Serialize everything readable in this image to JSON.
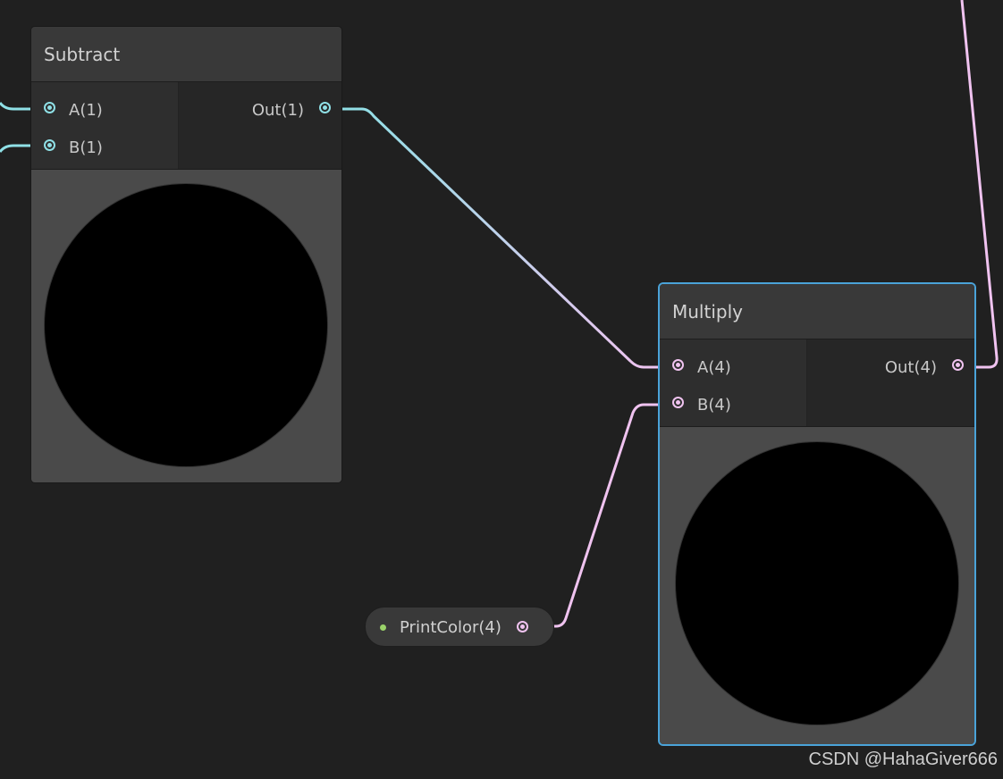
{
  "colors": {
    "background": "#202020",
    "float_port": "#8fe0e6",
    "vector4_port": "#f0c3f0",
    "selection_outline": "#4aa3d9",
    "property_dot": "#9bd36a"
  },
  "subtract_node": {
    "title": "Subtract",
    "inputs": [
      {
        "label": "A(1)",
        "port_icon": "float-port-icon"
      },
      {
        "label": "B(1)",
        "port_icon": "float-port-icon"
      }
    ],
    "output": {
      "label": "Out(1)",
      "port_icon": "float-port-icon"
    },
    "preview": "black-sphere-preview"
  },
  "multiply_node": {
    "title": "Multiply",
    "selected": true,
    "inputs": [
      {
        "label": "A(4)",
        "port_icon": "vector4-port-icon"
      },
      {
        "label": "B(4)",
        "port_icon": "vector4-port-icon"
      }
    ],
    "output": {
      "label": "Out(4)",
      "port_icon": "vector4-port-icon"
    },
    "preview": "black-sphere-preview"
  },
  "property_node": {
    "label": "PrintColor(4)",
    "port_icon": "vector4-port-icon"
  },
  "watermark": "CSDN @HahaGiver666"
}
